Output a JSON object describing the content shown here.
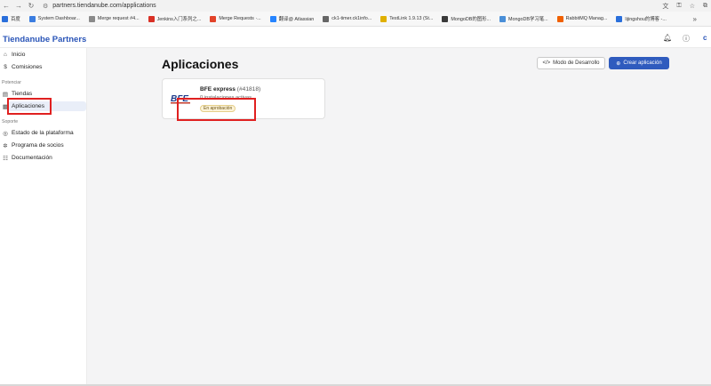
{
  "browser": {
    "url": "partners.tiendanube.com/applications",
    "bookmarks": [
      {
        "label": "百度",
        "color": "#2a6fdb"
      },
      {
        "label": "System Dashboar...",
        "color": "#3b7de0"
      },
      {
        "label": "Merge request #4...",
        "color": "#8a8a8a"
      },
      {
        "label": "Jenkins入门系列之...",
        "color": "#d93025"
      },
      {
        "label": "Merge Requests ·...",
        "color": "#e24329"
      },
      {
        "label": "翻译@ Atlassian",
        "color": "#2684ff"
      },
      {
        "label": "ck1-timer.ck1info...",
        "color": "#666666"
      },
      {
        "label": "TestLink 1.9.13 (St...",
        "color": "#e0b000"
      },
      {
        "label": "MongoDB的图形...",
        "color": "#3a3a3a"
      },
      {
        "label": "MongoDB学习笔...",
        "color": "#4a8fd8"
      },
      {
        "label": "RabbitMQ Manag...",
        "color": "#f06000"
      },
      {
        "label": "lijingshou的博客 -...",
        "color": "#2a6fdb"
      }
    ]
  },
  "header": {
    "brand": "Tiendanube Partners"
  },
  "sidebar": {
    "items_top": [
      {
        "label": "Inicio",
        "icon": "home-icon"
      },
      {
        "label": "Comisiones",
        "icon": "dollar-icon"
      }
    ],
    "section_potenciar": "Potenciar",
    "items_potenciar": [
      {
        "label": "Tiendas",
        "icon": "store-icon"
      },
      {
        "label": "Aplicaciones",
        "icon": "apps-icon"
      }
    ],
    "section_soporte": "Soporte",
    "items_soporte": [
      {
        "label": "Estado de la plataforma",
        "icon": "status-icon"
      },
      {
        "label": "Programa de socios",
        "icon": "partners-icon"
      },
      {
        "label": "Documentación",
        "icon": "docs-icon"
      }
    ]
  },
  "main": {
    "title": "Aplicaciones",
    "dev_mode_label": "Modo de Desarrollo",
    "create_label": "Crear aplicación",
    "app": {
      "name": "BFE express",
      "id": "(#41818)",
      "installs": "0 instalaciones activas",
      "status": "En aprobación",
      "logo_text": "BFE"
    }
  },
  "colors": {
    "brand": "#2a55b8",
    "primary_button": "#2f5bbe",
    "annotation": "#e02020"
  }
}
